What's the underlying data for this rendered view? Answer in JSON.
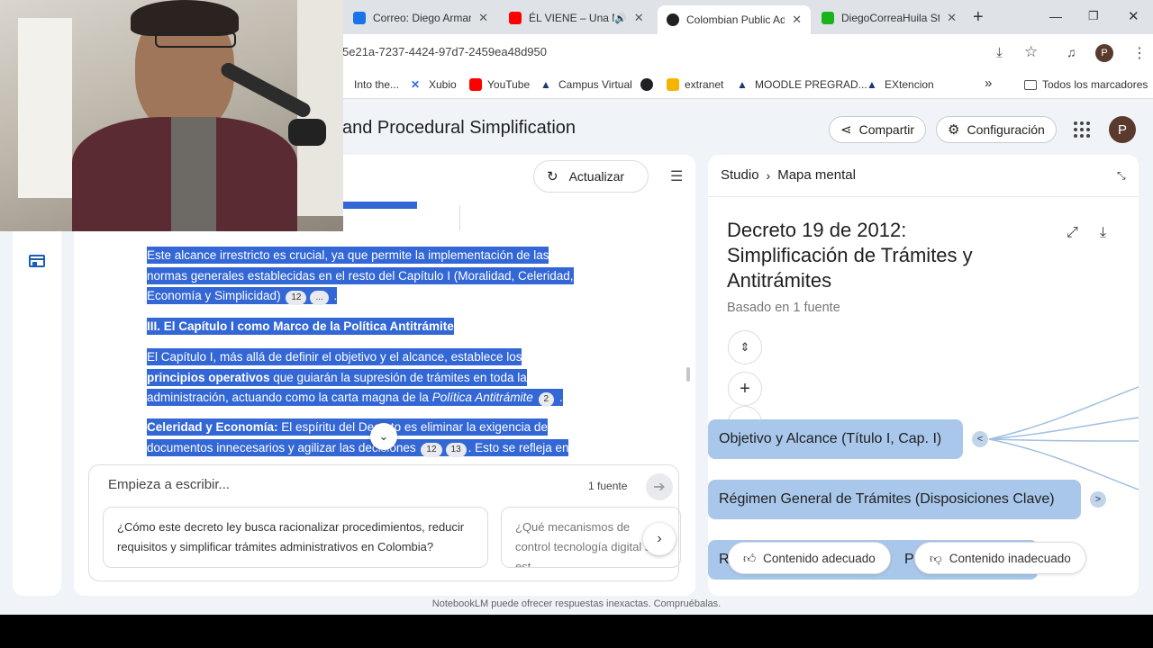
{
  "tabs": [
    {
      "title": "Correo: Diego Arman",
      "color": "#1a73e8"
    },
    {
      "title": "ÉL VIENE – Una N",
      "color": "#ff0000"
    },
    {
      "title": "Colombian Public Ad",
      "color": "#202124"
    },
    {
      "title": "DiegoCorreaHuila Str",
      "color": "#1bb31b"
    }
  ],
  "address": {
    "url": "5e21a-7237-4424-97d7-2459ea48d950"
  },
  "bookmarks": [
    {
      "label": "Into the...",
      "color": "#888888"
    },
    {
      "label": "Xubio",
      "color": "#2d6cdf"
    },
    {
      "label": "YouTube",
      "color": "#ff0000"
    },
    {
      "label": "Campus Virtual",
      "color": "#1a3a6b"
    },
    {
      "label": "",
      "color": "#202124"
    },
    {
      "label": "extranet",
      "color": "#f4b400"
    },
    {
      "label": "MOODLE PREGRAD...",
      "color": "#1a3a6b"
    },
    {
      "label": "EXtencion",
      "color": "#1a3a6b"
    }
  ],
  "bookmarks_more": "»",
  "all_bookmarks": "Todos los marcadores",
  "profile_letter": "P",
  "app": {
    "title": "and Procedural Simplification",
    "share": "Compartir",
    "settings": "Configuración"
  },
  "chat": {
    "refresh": "Actualizar",
    "para1_text": "Este alcance irrestricto es crucial, ya que permite la implementación de las normas generales establecidas en el resto del Capítulo I (Moralidad, Celeridad, Economía y Simplicidad)",
    "para1_cites": [
      "12",
      "..."
    ],
    "heading": "III. El Capítulo I como Marco de la Política Antitrámite",
    "para2_a": "El Capítulo I, más allá de definir el objetivo y el alcance, establece los ",
    "para2_bold": "principios operativos",
    "para2_b": " que guiarán la supresión de trámites en toda la administración, actuando como la carta magna de la ",
    "para2_italic": "Política Antitrámite",
    "para2_cite": "2",
    "para3_bold": "Celeridad y Economía:",
    "para3_a": " El espíritu del Decreto es eliminar la exigencia de documentos innecesarios y agilizar las decisiones",
    "para3_cites": [
      "12",
      "13"
    ],
    "para3_b": ". Esto se refleja en"
  },
  "input": {
    "placeholder": "Empieza a escribir...",
    "sources": "1 fuente",
    "suggestions": [
      "¿Cómo este decreto ley busca racionalizar procedimientos, reducir requisitos y simplificar trámites administrativos en Colombia?",
      "¿Qué mecanismos de control tecnología digital se est"
    ]
  },
  "studio": {
    "breadcrumb_root": "Studio",
    "breadcrumb_current": "Mapa mental",
    "title": "Decreto 19 de 2012: Simplificación de Trámites y Antitrámites",
    "subtitle": "Basado en 1 fuente",
    "nodes": [
      {
        "label": "Objetivo y Alcance (Título I, Cap. I)",
        "chevron": "<"
      },
      {
        "label": "Régimen General de Trámites (Disposiciones Clave)",
        "chevron": ">"
      },
      {
        "label": "R",
        "chevron": ""
      },
      {
        "label": "P",
        "chevron": ""
      }
    ],
    "feedback_good": "Contenido adecuado",
    "feedback_bad": "Contenido inadecuado"
  },
  "footer": "NotebookLM puede ofrecer respuestas inexactas. Compruébalas."
}
